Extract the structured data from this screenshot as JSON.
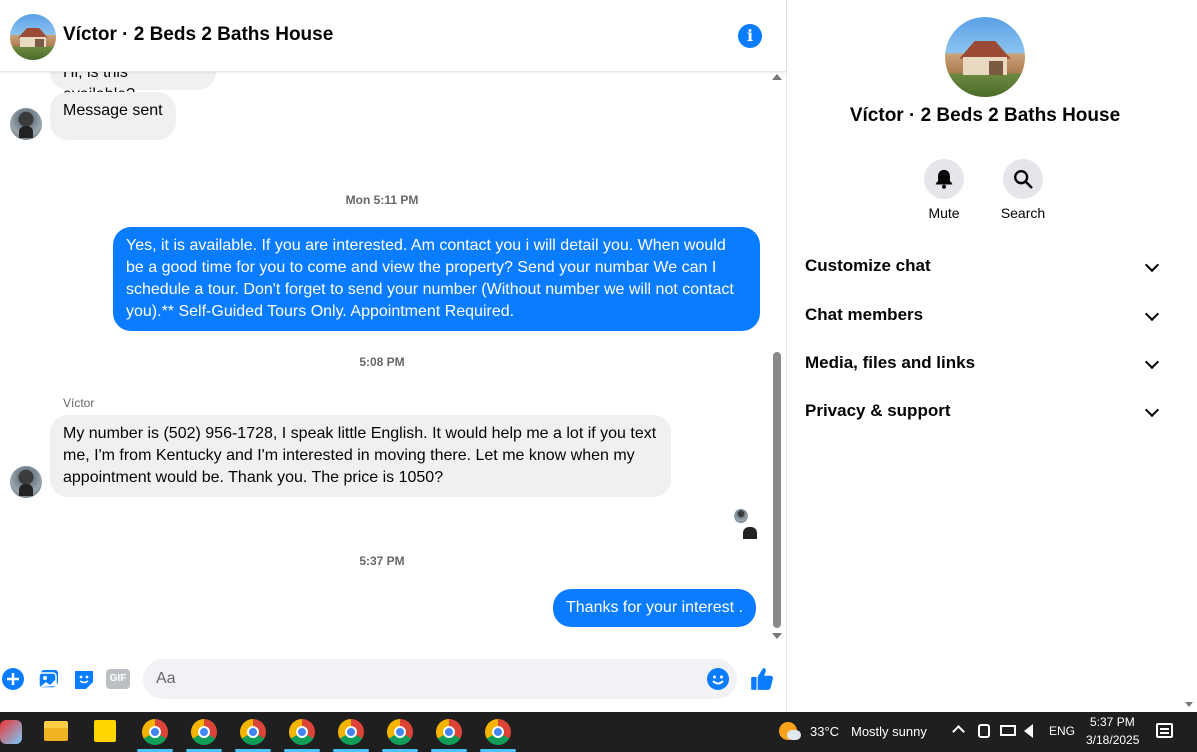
{
  "header": {
    "title": "Víctor · 2 Beds 2 Baths House",
    "info_icon": "i"
  },
  "messages": {
    "partial_top": "Hi, is this available?",
    "sent_notice": "Message sent",
    "time1": "Mon 5:11 PM",
    "outgoing1": "Yes, it is available. If you are interested.  Am contact you i will detail you.  When would be a good time for you to come and view the property? Send your numbar We can I schedule a tour.  Don't forget to send your number (Without number we will not contact you).** Self-Guided Tours Only. Appointment Required.",
    "time2": "5:08 PM",
    "sender_name": "Víctor",
    "incoming1": "My number is (502) 956-1728, I speak little English. It would help me a lot if you text me, I'm from Kentucky and I'm interested in moving there. Let me know when my appointment would be. Thank you. The price is 1050?",
    "time3": "5:37 PM",
    "outgoing2": "Thanks for your interest ."
  },
  "composer": {
    "placeholder": "Aa",
    "gif_label": "GIF"
  },
  "panel": {
    "title": "Víctor · 2 Beds 2 Baths House",
    "mute_label": "Mute",
    "search_label": "Search",
    "sections": [
      "Customize chat",
      "Chat members",
      "Media, files and links",
      "Privacy & support"
    ]
  },
  "taskbar": {
    "temperature": "33°C",
    "weather": "Mostly sunny",
    "language": "ENG",
    "time": "5:37 PM",
    "date": "3/18/2025"
  },
  "colors": {
    "accent": "#0a7cff",
    "incoming_bubble": "#f0f0f0",
    "taskbar": "#1f1f1f"
  }
}
